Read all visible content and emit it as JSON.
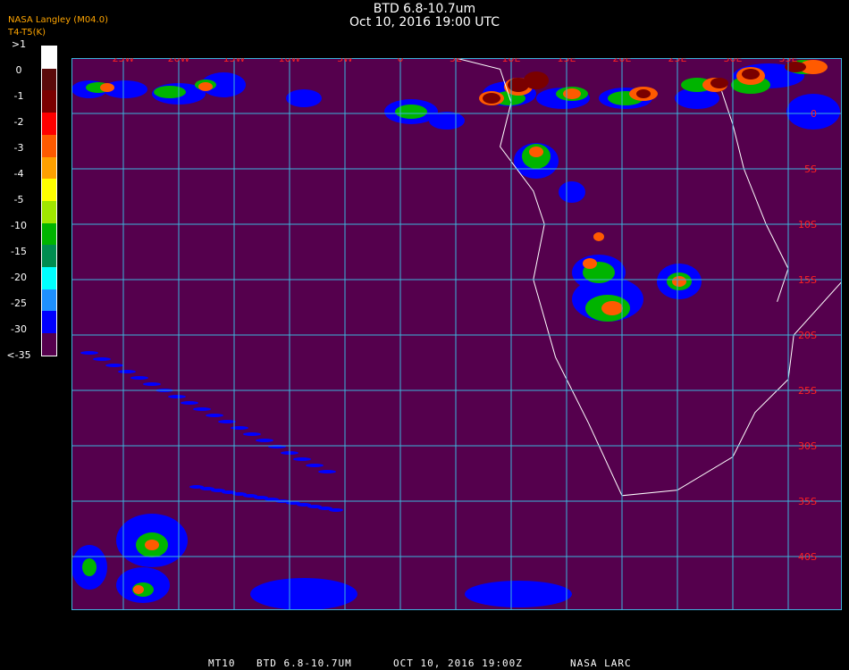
{
  "header": {
    "title": "BTD 6.8-10.7um",
    "subtitle": "Oct 10, 2016 19:00 UTC",
    "source_a": "NASA Langley (M04.0)",
    "source_b": "T4-T5(K)",
    "source_c": "BTD"
  },
  "legend": {
    "ticks": [
      ">1",
      "0",
      "-1",
      "-2",
      "-3",
      "-4",
      "-5",
      "-10",
      "-15",
      "-20",
      "-25",
      "-30",
      "<-35"
    ],
    "colors": [
      "#ffffff",
      "#5a0a0a",
      "#7a0000",
      "#ff0000",
      "#ff5a00",
      "#ffa000",
      "#ffff00",
      "#a0e600",
      "#00b400",
      "#008c50",
      "#00ffff",
      "#1e90ff",
      "#0000ff",
      "#55004d"
    ]
  },
  "map": {
    "lon_labels": [
      "25W",
      "20W",
      "15W",
      "10W",
      "5W",
      "0",
      "5E",
      "10E",
      "15E",
      "20E",
      "25E",
      "30E",
      "35E"
    ],
    "lat_labels": [
      "0",
      "5S",
      "10S",
      "15S",
      "20S",
      "25S",
      "30S",
      "35S",
      "40S"
    ],
    "background_color": "#55004d",
    "grid_color": "#3cb4dc",
    "coast_color": "#ffffff",
    "label_color": "#ff2020"
  },
  "footer": {
    "sat": "MT10",
    "product": "BTD 6.8-10.7UM",
    "date": "OCT 10, 2016 19:00Z",
    "org": "NASA LARC"
  }
}
